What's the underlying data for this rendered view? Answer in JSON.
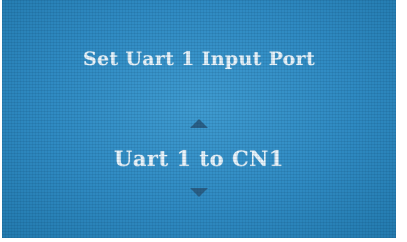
{
  "menu": {
    "title": "Set Uart 1 Input Port",
    "selected_option": "Uart 1 to CN1",
    "up_icon": "arrow-up-icon",
    "down_icon": "arrow-down-icon"
  },
  "colors": {
    "screen_background": "#2f8ac2",
    "text": "#e9f4fb",
    "arrow": "#2a5f86"
  }
}
